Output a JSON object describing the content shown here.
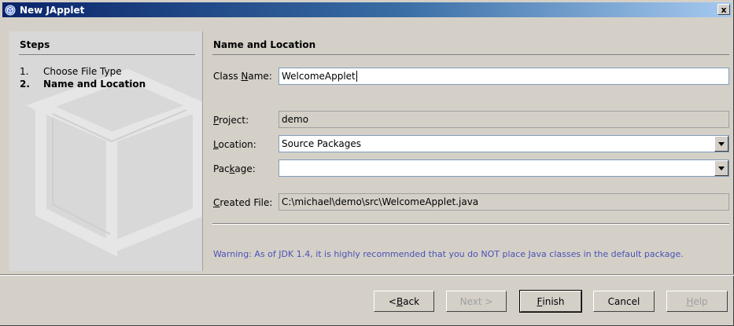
{
  "window": {
    "title": "New JApplet",
    "close_glyph": "x"
  },
  "steps": {
    "heading": "Steps",
    "items": [
      {
        "num": "1.",
        "label": "Choose File Type",
        "current": false
      },
      {
        "num": "2.",
        "label": "Name and Location",
        "current": true
      }
    ]
  },
  "panel": {
    "title": "Name and Location",
    "class_name": {
      "label_pre": "Class ",
      "label_mnemonic": "N",
      "label_post": "ame:",
      "value": "WelcomeApplet"
    },
    "project": {
      "label_pre": "",
      "label_mnemonic": "P",
      "label_post": "roject:",
      "value": "demo"
    },
    "location": {
      "label_pre": "",
      "label_mnemonic": "L",
      "label_post": "ocation:",
      "value": "Source Packages"
    },
    "package": {
      "label_pre": "Pac",
      "label_mnemonic": "k",
      "label_post": "age:",
      "value": ""
    },
    "created_file": {
      "label_pre": "",
      "label_mnemonic": "C",
      "label_post": "reated File:",
      "value": "C:\\michael\\demo\\src\\WelcomeApplet.java"
    },
    "warning": "Warning: As of JDK 1.4, it is highly recommended that you do NOT place Java classes in the default package."
  },
  "buttons": {
    "back": {
      "pre": "< ",
      "mnemonic": "B",
      "post": "ack"
    },
    "next": {
      "label": "Next >"
    },
    "finish": {
      "pre": "",
      "mnemonic": "F",
      "post": "inish"
    },
    "cancel": {
      "label": "Cancel"
    },
    "help": {
      "pre": "",
      "mnemonic": "H",
      "post": "elp"
    }
  },
  "colors": {
    "titlebar_start": "#0a246a",
    "titlebar_end": "#a6caf0",
    "warning_text": "#4b51b5",
    "dialog_bg": "#d4d0c8"
  },
  "icons": {
    "title": "netbeans-cube-icon",
    "dropdown": "triangle-down-icon"
  }
}
